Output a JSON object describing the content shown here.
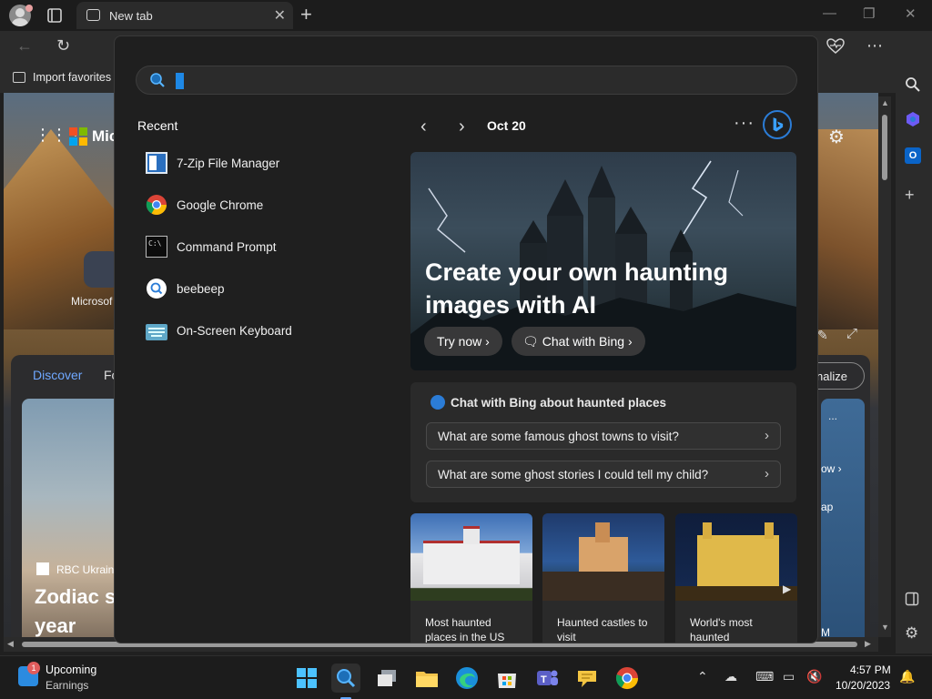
{
  "browser": {
    "tab_title": "New tab",
    "favorites_bar": {
      "import_label": "Import favorites"
    },
    "page": {
      "ms_text": "Mic",
      "ms_label": "Microsof",
      "feed_tabs": [
        "Discover",
        "Fo"
      ],
      "personalize": "nalize",
      "card_source": "RBC Ukraine",
      "card_title": "Zodiac s\nyear",
      "right_card": {
        "link": "ow",
        "button": "ap",
        "dots": "...",
        "m": "M"
      }
    }
  },
  "search": {
    "placeholder": "",
    "recent_title": "Recent",
    "recent": [
      {
        "label": "7-Zip File Manager",
        "icon": "7zip-icon"
      },
      {
        "label": "Google Chrome",
        "icon": "chrome-icon"
      },
      {
        "label": "Command Prompt",
        "icon": "terminal-icon"
      },
      {
        "label": "beebeep",
        "icon": "search-icon"
      },
      {
        "label": "On-Screen Keyboard",
        "icon": "keyboard-icon"
      }
    ],
    "date": "Oct 20",
    "hero": {
      "title": "Create your own haunting images with AI",
      "try_now": "Try now",
      "chat_with_bing": "Chat with Bing"
    },
    "chat": {
      "heading": "Chat with Bing about haunted places",
      "questions": [
        "What are some famous ghost towns to visit?",
        "What are some ghost stories I could tell my child?"
      ]
    },
    "tiles": [
      {
        "caption": "Most haunted places in the US"
      },
      {
        "caption": "Haunted castles to visit"
      },
      {
        "caption": "World's most haunted"
      }
    ]
  },
  "taskbar": {
    "widget_badge": "1",
    "widget_title": "Upcoming",
    "widget_subtitle": "Earnings",
    "time": "4:57 PM",
    "date": "10/20/2023"
  },
  "colors": {
    "accent": "#1e88e5",
    "bing_blue": "#2b7cd6",
    "panel_bg": "#1f1f1f"
  }
}
